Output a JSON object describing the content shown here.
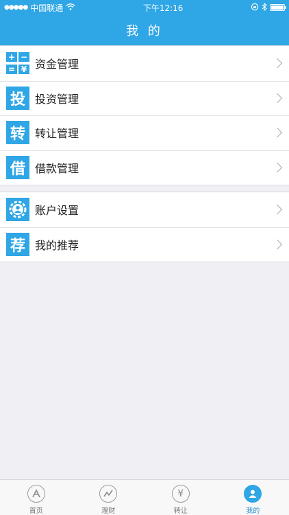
{
  "status_bar": {
    "carrier": "中国联通",
    "time": "下午12:16"
  },
  "header": {
    "title": "我 的"
  },
  "group1": [
    {
      "label": "资金管理",
      "icon": "calculator-icon"
    },
    {
      "label": "投资管理",
      "icon_char": "投"
    },
    {
      "label": "转让管理",
      "icon_char": "转"
    },
    {
      "label": "借款管理",
      "icon_char": "借"
    }
  ],
  "group2": [
    {
      "label": "账户设置",
      "icon": "account-gear-icon"
    },
    {
      "label": "我的推荐",
      "icon_char": "荐"
    }
  ],
  "calc_icon": [
    "+",
    "−",
    "=",
    "¥"
  ],
  "tabs": [
    {
      "label": "首页",
      "icon": "home-icon"
    },
    {
      "label": "理财",
      "icon": "chart-icon"
    },
    {
      "label": "转让",
      "icon": "yen-icon",
      "icon_char": "¥"
    },
    {
      "label": "我的",
      "icon": "user-icon",
      "active": true
    }
  ],
  "colors": {
    "accent": "#2fa6e5",
    "background": "#efeff4"
  }
}
